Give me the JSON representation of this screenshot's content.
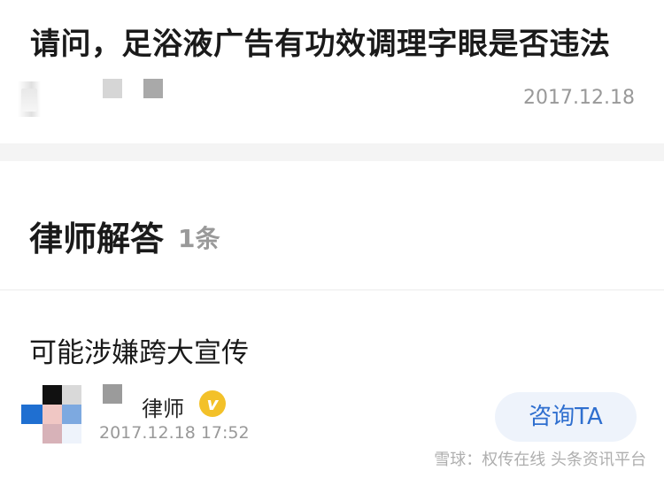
{
  "question": {
    "title": "请问，足浴液广告有功效调理字眼是否违法",
    "date": "2017.12.18"
  },
  "answers_header": {
    "title": "律师解答",
    "count": "1条"
  },
  "answer": {
    "text": "可能涉嫌跨大宣传",
    "lawyer_role": "律师",
    "verified_icon_glyph": "v",
    "timestamp": "2017.12.18 17:52",
    "consult_button_label": "咨询TA"
  },
  "watermark": {
    "text": "雪球：权传在线 头条资讯平台"
  },
  "icons": {
    "verified": "verified-badge-icon"
  },
  "colors": {
    "accent": "#2f6fcf",
    "verified_badge": "#f3c129",
    "button_bg": "#eef3fb",
    "muted_text": "#999999"
  }
}
